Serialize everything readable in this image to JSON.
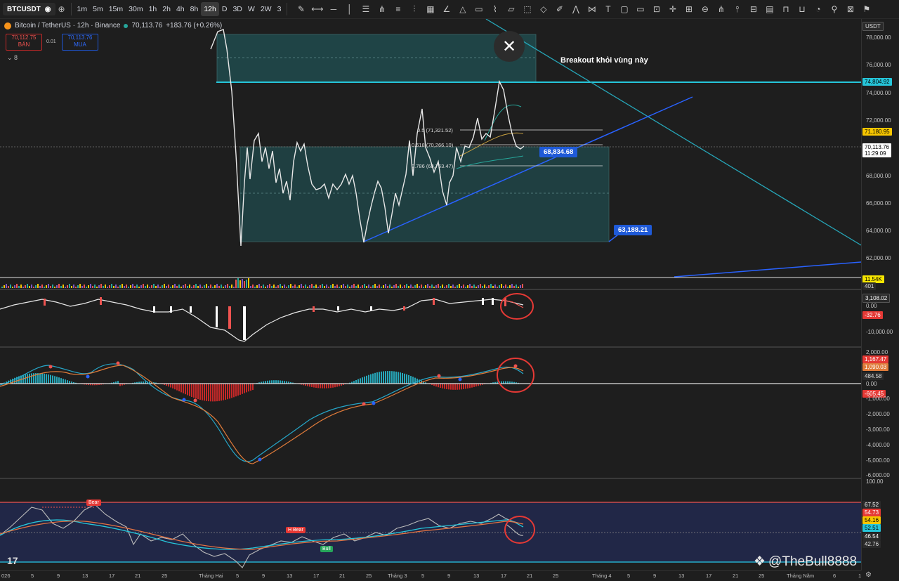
{
  "toolbar": {
    "symbol": "BTCUSDT",
    "timeframes": [
      "1m",
      "5m",
      "15m",
      "30m",
      "1h",
      "2h",
      "4h",
      "8h",
      "12h",
      "D",
      "3D",
      "W",
      "2W",
      "3"
    ],
    "active_timeframe": "12h"
  },
  "legend": {
    "title": "Bitcoin / TetherUS · 12h · Binance",
    "price": "70,113.76",
    "change": "+183.76 (+0.26%)",
    "sell_price": "70,112.75",
    "sell_label": "BÁN",
    "spread": "0.01",
    "buy_price": "70,113.76",
    "buy_label": "MUA",
    "indicator_count": "8"
  },
  "annotations": {
    "close_glyph": "✕",
    "breakout_text": "Breakout khỏi vùng này",
    "box_label_1": "68,834.68",
    "box_label_2": "63,188.21",
    "fib_05": "0.5 (71,321.52)",
    "fib_0618": "0.618 (70,266.10)",
    "fib_0786": "0.786 (68,763.47)",
    "rsi_bear": "Bear",
    "rsi_hbear": "H Bear",
    "rsi_bull": "Bull",
    "watermark": "@TheBull8888",
    "tv_logo": "17"
  },
  "price_axis": {
    "currency": "USDT",
    "labels": [
      "78,000.00",
      "76,000.00",
      "74,000.00",
      "72,000.00",
      "68,000.00",
      "66,000.00",
      "64,000.00",
      "62,000.00"
    ],
    "tag_high": "74,804.92",
    "tag_yellow": "71,180.95",
    "tag_last": "70,113.76",
    "tag_countdown": "11:29:09",
    "vol_tag": "11.54K",
    "vol_tag2": "401",
    "obv_tag": "3,108.02",
    "obv_zero": "0.00",
    "obv_neg": "-32.76",
    "obv_label": "-10,000.00",
    "macd_labels": [
      "2,000.00",
      "-1,000.00",
      "-2,000.00",
      "-3,000.00",
      "-4,000.00",
      "-5,000.00",
      "-6,000.00"
    ],
    "macd_tag1": "1,167.47",
    "macd_tag2": "1,090.03",
    "macd_tag3": "484.58",
    "macd_zero": "0.00",
    "macd_neg": "-605.45",
    "rsi_top": "100.00",
    "rsi_tag1": "67.52",
    "rsi_tag2": "54.73",
    "rsi_tag3": "54.16",
    "rsi_tag4": "52.51",
    "rsi_tag5": "46.54",
    "rsi_tag6": "42.76"
  },
  "time_axis": [
    "026",
    "5",
    "9",
    "13",
    "17",
    "21",
    "25",
    "Tháng Hai",
    "5",
    "9",
    "13",
    "17",
    "21",
    "25",
    "Tháng 3",
    "5",
    "9",
    "13",
    "17",
    "21",
    "25",
    "Tháng 4",
    "5",
    "9",
    "13",
    "17",
    "21",
    "25",
    "Tháng Năm",
    "6",
    "1"
  ],
  "colors": {
    "background": "#1e1e1e",
    "price_line": "#e8e8e8",
    "zone_fill": "#1f4a4a",
    "cyan": "#26c6da",
    "trend_blue": "#2962ff",
    "red_circle": "#e53935"
  }
}
